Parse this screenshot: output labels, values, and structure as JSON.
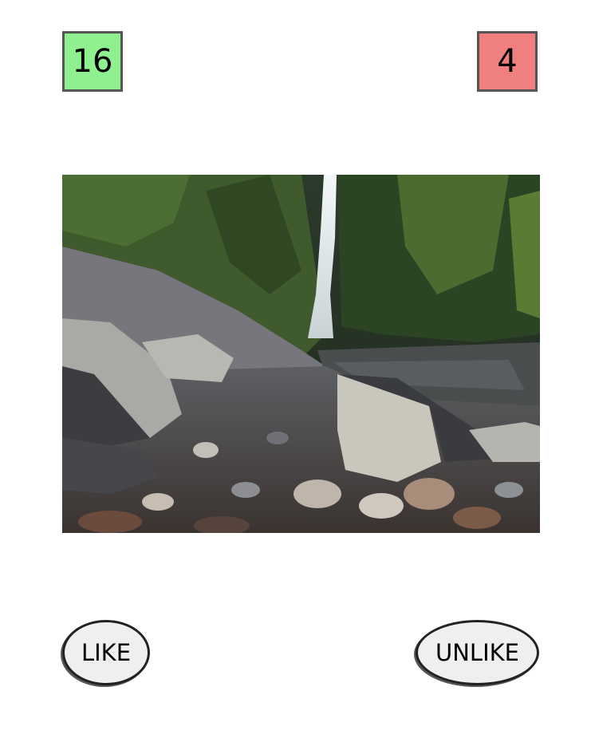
{
  "counters": {
    "likes": "16",
    "unlikes": "4",
    "likes_color": "#8ef08e",
    "unlikes_color": "#f08080"
  },
  "photo": {
    "alt": "Waterfall in a forested rocky gorge"
  },
  "buttons": {
    "like_label": "LIKE",
    "unlike_label": "UNLIKE"
  }
}
